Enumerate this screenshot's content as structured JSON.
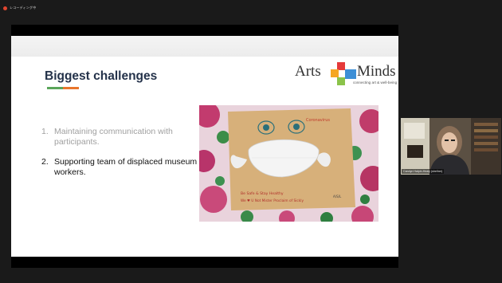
{
  "recording": {
    "label": "レコーディング中",
    "indicator_color": "#e0452f"
  },
  "slide": {
    "title": "Biggest challenges",
    "underline_colors": [
      "#5aa55a",
      "#e8762c"
    ],
    "logo": {
      "left_word": "Arts",
      "right_word": "Minds",
      "tagline": "connecting art & well-being",
      "square_colors": [
        "#e53a3a",
        "#f5a623",
        "#3d8fd6",
        "#8bc34a"
      ]
    },
    "bullets": [
      {
        "number": "1.",
        "text": "Maintaining communication with participants.",
        "state": "dimmed"
      },
      {
        "number": "2.",
        "text": "Supporting team of displaced museum workers.",
        "state": "active"
      }
    ],
    "photo": {
      "description_icon": "mask-card-photo",
      "card_heading": "Coronavirus",
      "card_line1": "Be Safe & Stay Healthy",
      "card_line2": "We ♥ U Not Mister Proclaim of Sickly",
      "card_signature": "A/S/L"
    }
  },
  "participant": {
    "name": "Carolyn Halpin-Healy (she/her)"
  }
}
